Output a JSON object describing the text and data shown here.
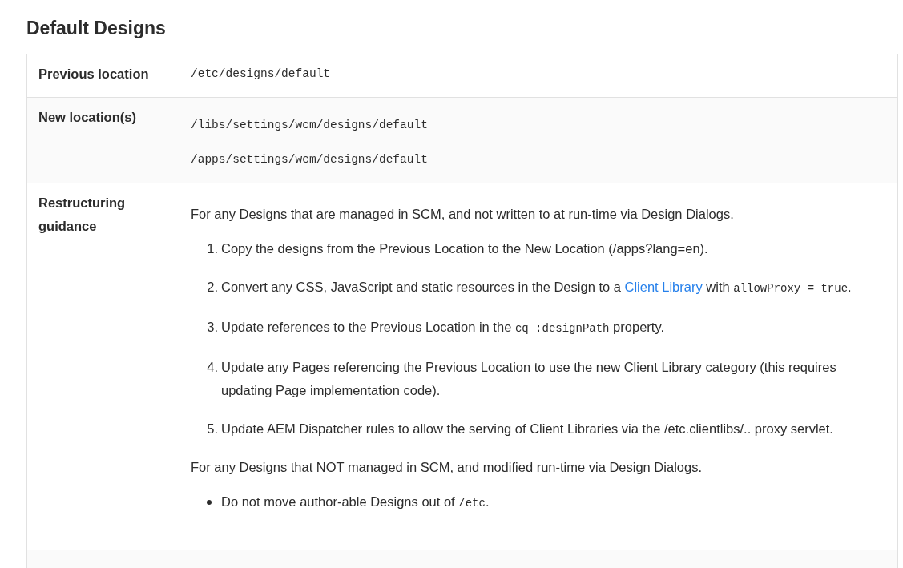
{
  "heading": "Default Designs",
  "table": {
    "rows": [
      {
        "label": "Previous location",
        "blocks": [
          {
            "kind": "code",
            "text": "/etc/designs/default"
          }
        ]
      },
      {
        "label": "New location(s)",
        "blocks": [
          {
            "kind": "code",
            "text": "/libs/settings/wcm/designs/default"
          },
          {
            "kind": "code",
            "text": "/apps/settings/wcm/designs/default"
          }
        ]
      },
      {
        "label": "Restructuring guidance",
        "blocks": [
          {
            "kind": "paragraph",
            "segments": [
              {
                "kind": "text",
                "text": "For any Designs that are managed in SCM, and not written to at run-time via Design Dialogs."
              }
            ]
          },
          {
            "kind": "ordered_list",
            "items": [
              {
                "number": "1.",
                "segments": [
                  {
                    "kind": "text",
                    "text": "Copy the designs from the Previous Location to the New Location (/apps?lang=en)."
                  }
                ]
              },
              {
                "number": "2.",
                "segments": [
                  {
                    "kind": "text",
                    "text": "Convert any CSS, JavaScript and static resources in the Design to a "
                  },
                  {
                    "kind": "link",
                    "text": "Client Library"
                  },
                  {
                    "kind": "text",
                    "text": " with "
                  },
                  {
                    "kind": "code",
                    "text": "allowProxy = true"
                  },
                  {
                    "kind": "text",
                    "text": "."
                  }
                ]
              },
              {
                "number": "3.",
                "segments": [
                  {
                    "kind": "text",
                    "text": "Update references to the Previous Location in the "
                  },
                  {
                    "kind": "code",
                    "text": "cq :designPath"
                  },
                  {
                    "kind": "text",
                    "text": " property."
                  }
                ]
              },
              {
                "number": "4.",
                "segments": [
                  {
                    "kind": "text",
                    "text": "Update any Pages referencing the Previous Location to use the new Client Library category (this requires updating Page implementation code)."
                  }
                ]
              },
              {
                "number": "5.",
                "segments": [
                  {
                    "kind": "text",
                    "text": "Update AEM Dispatcher rules to allow the serving of Client Libraries via the /etc.clientlibs/.. proxy servlet."
                  }
                ]
              }
            ]
          },
          {
            "kind": "paragraph",
            "segments": [
              {
                "kind": "text",
                "text": "For any Designs that NOT managed in SCM, and modified run-time via Design Dialogs."
              }
            ]
          },
          {
            "kind": "bullet_list",
            "items": [
              {
                "segments": [
                  {
                    "kind": "text",
                    "text": "Do not move author-able Designs out of "
                  },
                  {
                    "kind": "code",
                    "text": "/etc"
                  },
                  {
                    "kind": "text",
                    "text": "."
                  }
                ]
              }
            ]
          }
        ]
      }
    ]
  }
}
